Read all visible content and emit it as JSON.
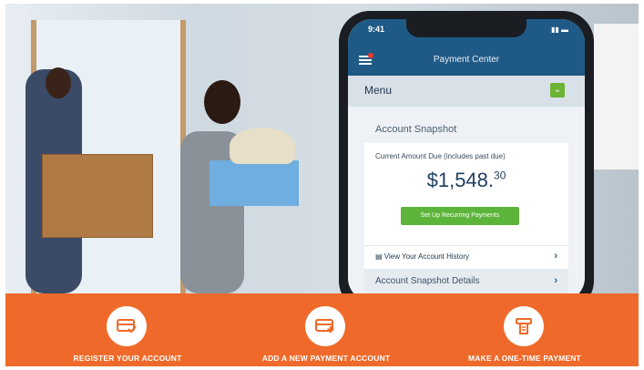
{
  "phone": {
    "time": "9:41",
    "header_title": "Payment Center",
    "menu_label": "Menu",
    "card": {
      "title": "Account Snapshot",
      "due_label": "Current Amount Due (includes past due)",
      "amount_main": "$1,548.",
      "amount_cents": "30",
      "cta_label": "Set Up Recurring Payments",
      "history_label": "View Your Account History",
      "details_label": "Account Snapshot Details"
    }
  },
  "actions": [
    {
      "label": "REGISTER YOUR ACCOUNT",
      "icon": "card-check-icon"
    },
    {
      "label": "ADD A NEW PAYMENT ACCOUNT",
      "icon": "card-plus-icon"
    },
    {
      "label": "MAKE A ONE-TIME PAYMENT",
      "icon": "receipt-icon"
    }
  ],
  "colors": {
    "band": "#ef6a2a",
    "primary_blue": "#1f5a86",
    "green_button": "#5db43a"
  }
}
